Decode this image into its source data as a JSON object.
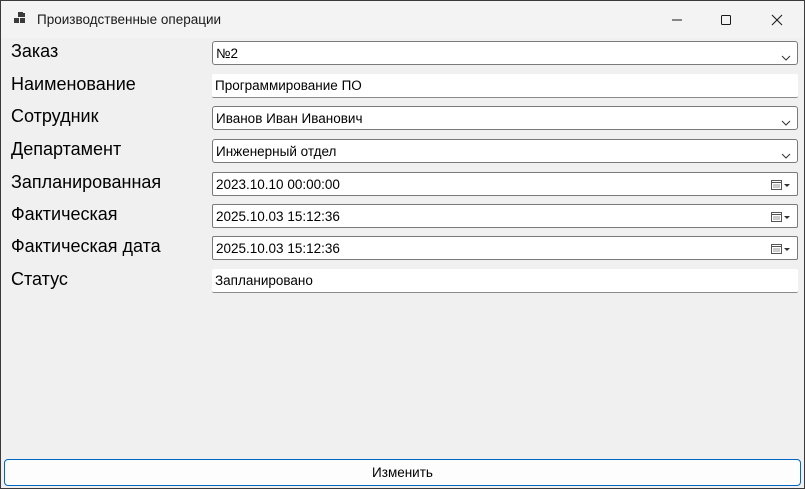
{
  "window": {
    "title": "Производственные операции"
  },
  "fields": {
    "order": {
      "label": "Заказ",
      "value": "№2"
    },
    "name": {
      "label": "Наименование",
      "value": "Программирование ПО"
    },
    "employee": {
      "label": "Сотрудник",
      "value": "Иванов Иван Иванович"
    },
    "department": {
      "label": "Департамент",
      "value": "Инженерный отдел"
    },
    "planned": {
      "label": "Запланированная",
      "value": "2023.10.10 00:00:00"
    },
    "actual": {
      "label": "Фактическая",
      "value": "2025.10.03 15:12:36"
    },
    "actual_date": {
      "label": "Фактическая дата",
      "value": "2025.10.03 15:12:36"
    },
    "status": {
      "label": "Статус",
      "value": "Запланировано"
    }
  },
  "buttons": {
    "change_label": "Изменить"
  },
  "icons": {
    "app": "app-windows-icon",
    "minimize": "minimize-icon",
    "maximize": "maximize-icon",
    "close": "close-icon",
    "dropdown": "chevron-down-icon",
    "calendar": "calendar-icon"
  },
  "colors": {
    "window_bg": "#f0f0f0",
    "field_bg": "#ffffff",
    "button_border": "#0067c0"
  }
}
